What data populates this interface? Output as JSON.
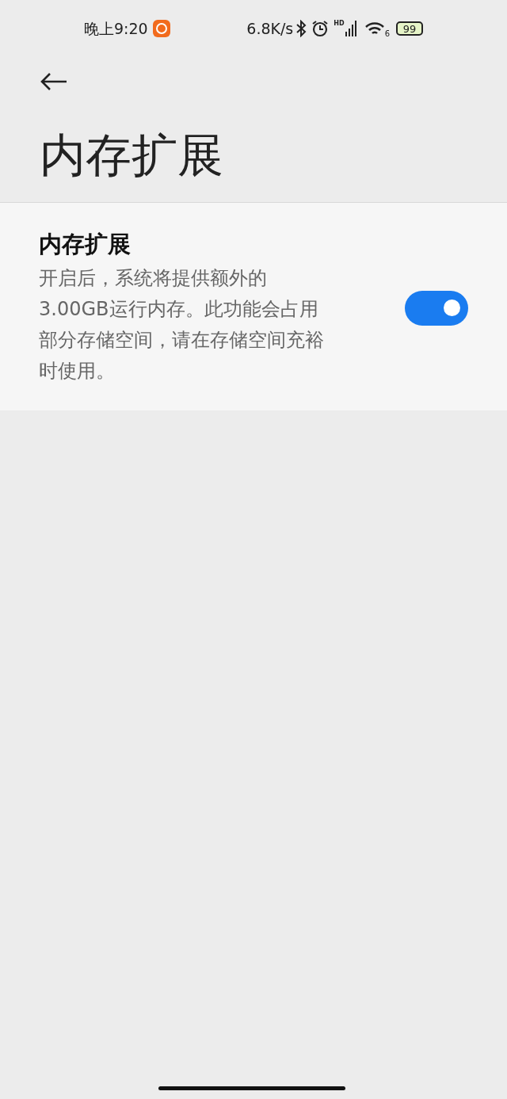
{
  "status_bar": {
    "time": "晚上9:20",
    "net_speed": "6.8K/s",
    "signal_label": "HD",
    "wifi_badge": "6",
    "battery": "99"
  },
  "page": {
    "title": "内存扩展"
  },
  "settings": [
    {
      "kind": "toggle",
      "title": "内存扩展",
      "description_lines": [
        "开启后，系统将提供额外的",
        "3.00GB运行内存。此功能会占用",
        "部分存储空间，请在存储空间充裕",
        "时使用。"
      ],
      "on": true
    }
  ]
}
